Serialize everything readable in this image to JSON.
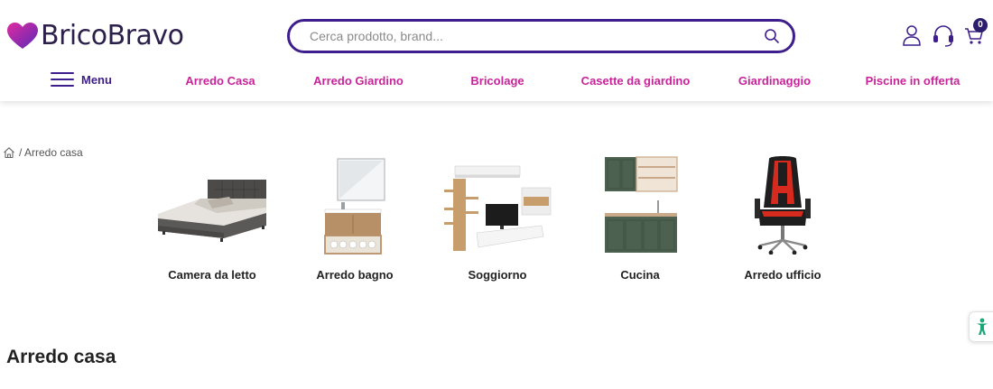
{
  "header": {
    "logo_text": "BricoBravo",
    "search": {
      "placeholder": "Cerca prodotto, brand..."
    },
    "icons": [
      "user-icon",
      "support-headset-icon",
      "cart-icon"
    ],
    "cart_count": "0"
  },
  "nav": {
    "menu_label": "Menu",
    "items": [
      {
        "label": "Arredo Casa"
      },
      {
        "label": "Arredo Giardino"
      },
      {
        "label": "Bricolage"
      },
      {
        "label": "Casette da giardino"
      },
      {
        "label": "Giardinaggio"
      },
      {
        "label": "Piscine in offerta"
      }
    ]
  },
  "breadcrumb": {
    "text": "/ Arredo casa"
  },
  "categories": [
    {
      "label": "Camera da letto"
    },
    {
      "label": "Arredo bagno"
    },
    {
      "label": "Soggiorno"
    },
    {
      "label": "Cucina"
    },
    {
      "label": "Arredo ufficio"
    }
  ],
  "page_title": "Arredo casa",
  "colors": {
    "brand_purple": "#3d1e8c",
    "brand_magenta": "#c8239a",
    "accessibility_green": "#1aa67a"
  }
}
